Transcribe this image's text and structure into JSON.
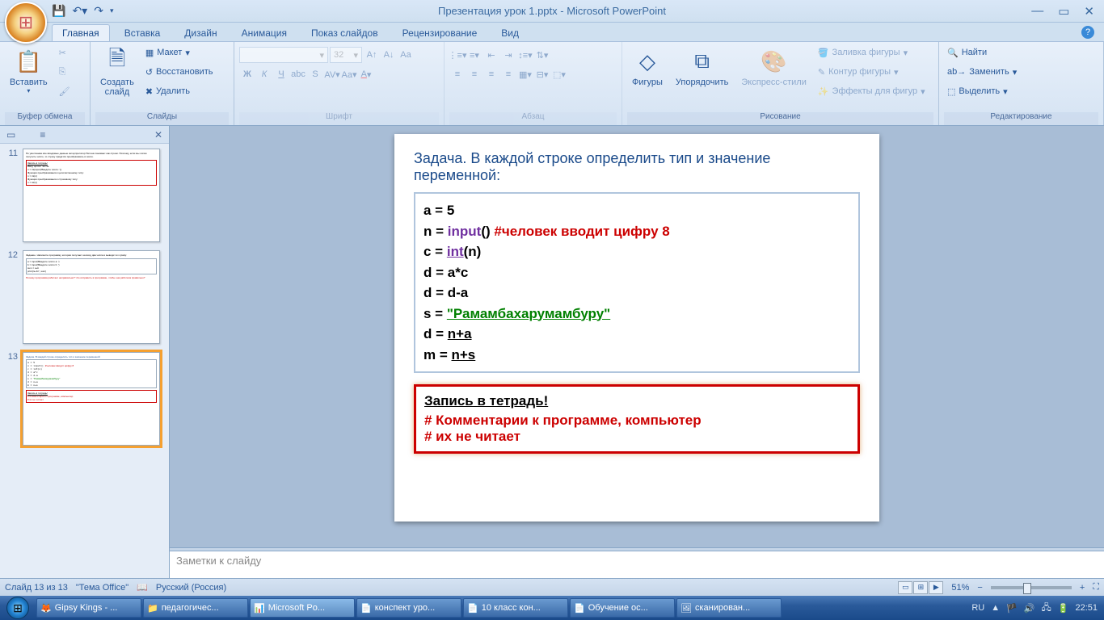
{
  "title": "Презентация урок 1.pptx - Microsoft PowerPoint",
  "tabs": [
    "Главная",
    "Вставка",
    "Дизайн",
    "Анимация",
    "Показ слайдов",
    "Рецензирование",
    "Вид"
  ],
  "groups": {
    "clipboard": {
      "label": "Буфер обмена",
      "paste": "Вставить"
    },
    "slides": {
      "label": "Слайды",
      "new": "Создать\nслайд",
      "layout": "Макет",
      "reset": "Восстановить",
      "delete": "Удалить"
    },
    "font": {
      "label": "Шрифт",
      "size": "32"
    },
    "paragraph": {
      "label": "Абзац"
    },
    "drawing": {
      "label": "Рисование",
      "shapes": "Фигуры",
      "arrange": "Упорядочить",
      "quick": "Экспресс-стили",
      "fill": "Заливка фигуры",
      "outline": "Контур фигуры",
      "effects": "Эффекты для фигур"
    },
    "editing": {
      "label": "Редактирование",
      "find": "Найти",
      "replace": "Заменить",
      "select": "Выделить"
    }
  },
  "slide_content": {
    "title": "Задача. В каждой строке определить тип и значение переменной:",
    "lines": [
      {
        "p": "a = ",
        "t": "5"
      },
      {
        "p": "n = ",
        "fn": "input",
        "t2": "()",
        "cmt": "   #человек вводит цифру 8"
      },
      {
        "p": "c = ",
        "fn2": "int",
        "t3": "(n)"
      },
      {
        "p": "d = a*c"
      },
      {
        "p": "d = d-a"
      },
      {
        "p": "s = ",
        "str": "\"Рамамбахарумамбуру\""
      },
      {
        "p": "d = ",
        "expr": "n+a"
      },
      {
        "p": "m = ",
        "expr": "n+s"
      }
    ],
    "note_hdr": "Запись в тетрадь!",
    "note_l1": "# Комментарии к программе, компьютер",
    "note_l2": "# их не читает"
  },
  "notes_placeholder": "Заметки к слайду",
  "status": {
    "slide": "Слайд 13 из 13",
    "theme": "\"Тема Office\"",
    "lang": "Русский (Россия)",
    "zoom": "51%"
  },
  "thumbs": [
    11,
    12,
    13
  ],
  "taskbar": [
    {
      "icon": "🦊",
      "label": "Gipsy Kings - ..."
    },
    {
      "icon": "📁",
      "label": "педагогичес..."
    },
    {
      "icon": "📊",
      "label": "Microsoft Po...",
      "active": true
    },
    {
      "icon": "📄",
      "label": "конспект уро..."
    },
    {
      "icon": "📄",
      "label": "10 класс кон..."
    },
    {
      "icon": "📄",
      "label": "Обучение ос..."
    },
    {
      "icon": "🖼",
      "label": "сканирован..."
    }
  ],
  "tray": {
    "lang": "RU",
    "time": "22:51"
  }
}
